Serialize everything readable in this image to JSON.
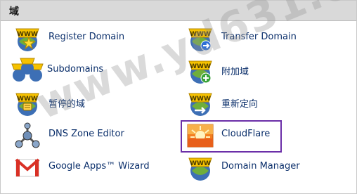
{
  "section": {
    "title": "域"
  },
  "items": [
    {
      "label": "Register Domain",
      "icon": "www-globe-star-icon"
    },
    {
      "label": "Transfer Domain",
      "icon": "www-globe-transfer-icon"
    },
    {
      "label": "Subdomains",
      "icon": "www-globe-multi-icon"
    },
    {
      "label": "附加域",
      "icon": "www-globe-plus-icon"
    },
    {
      "label": "暂停的域",
      "icon": "www-globe-park-icon"
    },
    {
      "label": "重新定向",
      "icon": "www-globe-redirect-icon"
    },
    {
      "label": "DNS Zone Editor",
      "icon": "dns-network-icon"
    },
    {
      "label": "CloudFlare",
      "icon": "cloudflare-icon"
    },
    {
      "label": "Google Apps™ Wizard",
      "icon": "gmail-icon"
    },
    {
      "label": "Domain Manager",
      "icon": "www-globe-manager-icon"
    }
  ],
  "watermark": "www.yd631.com",
  "colors": {
    "link": "#0b2f6b",
    "header_bg": "#d9d9d9",
    "highlight": "#6b2fa8"
  }
}
